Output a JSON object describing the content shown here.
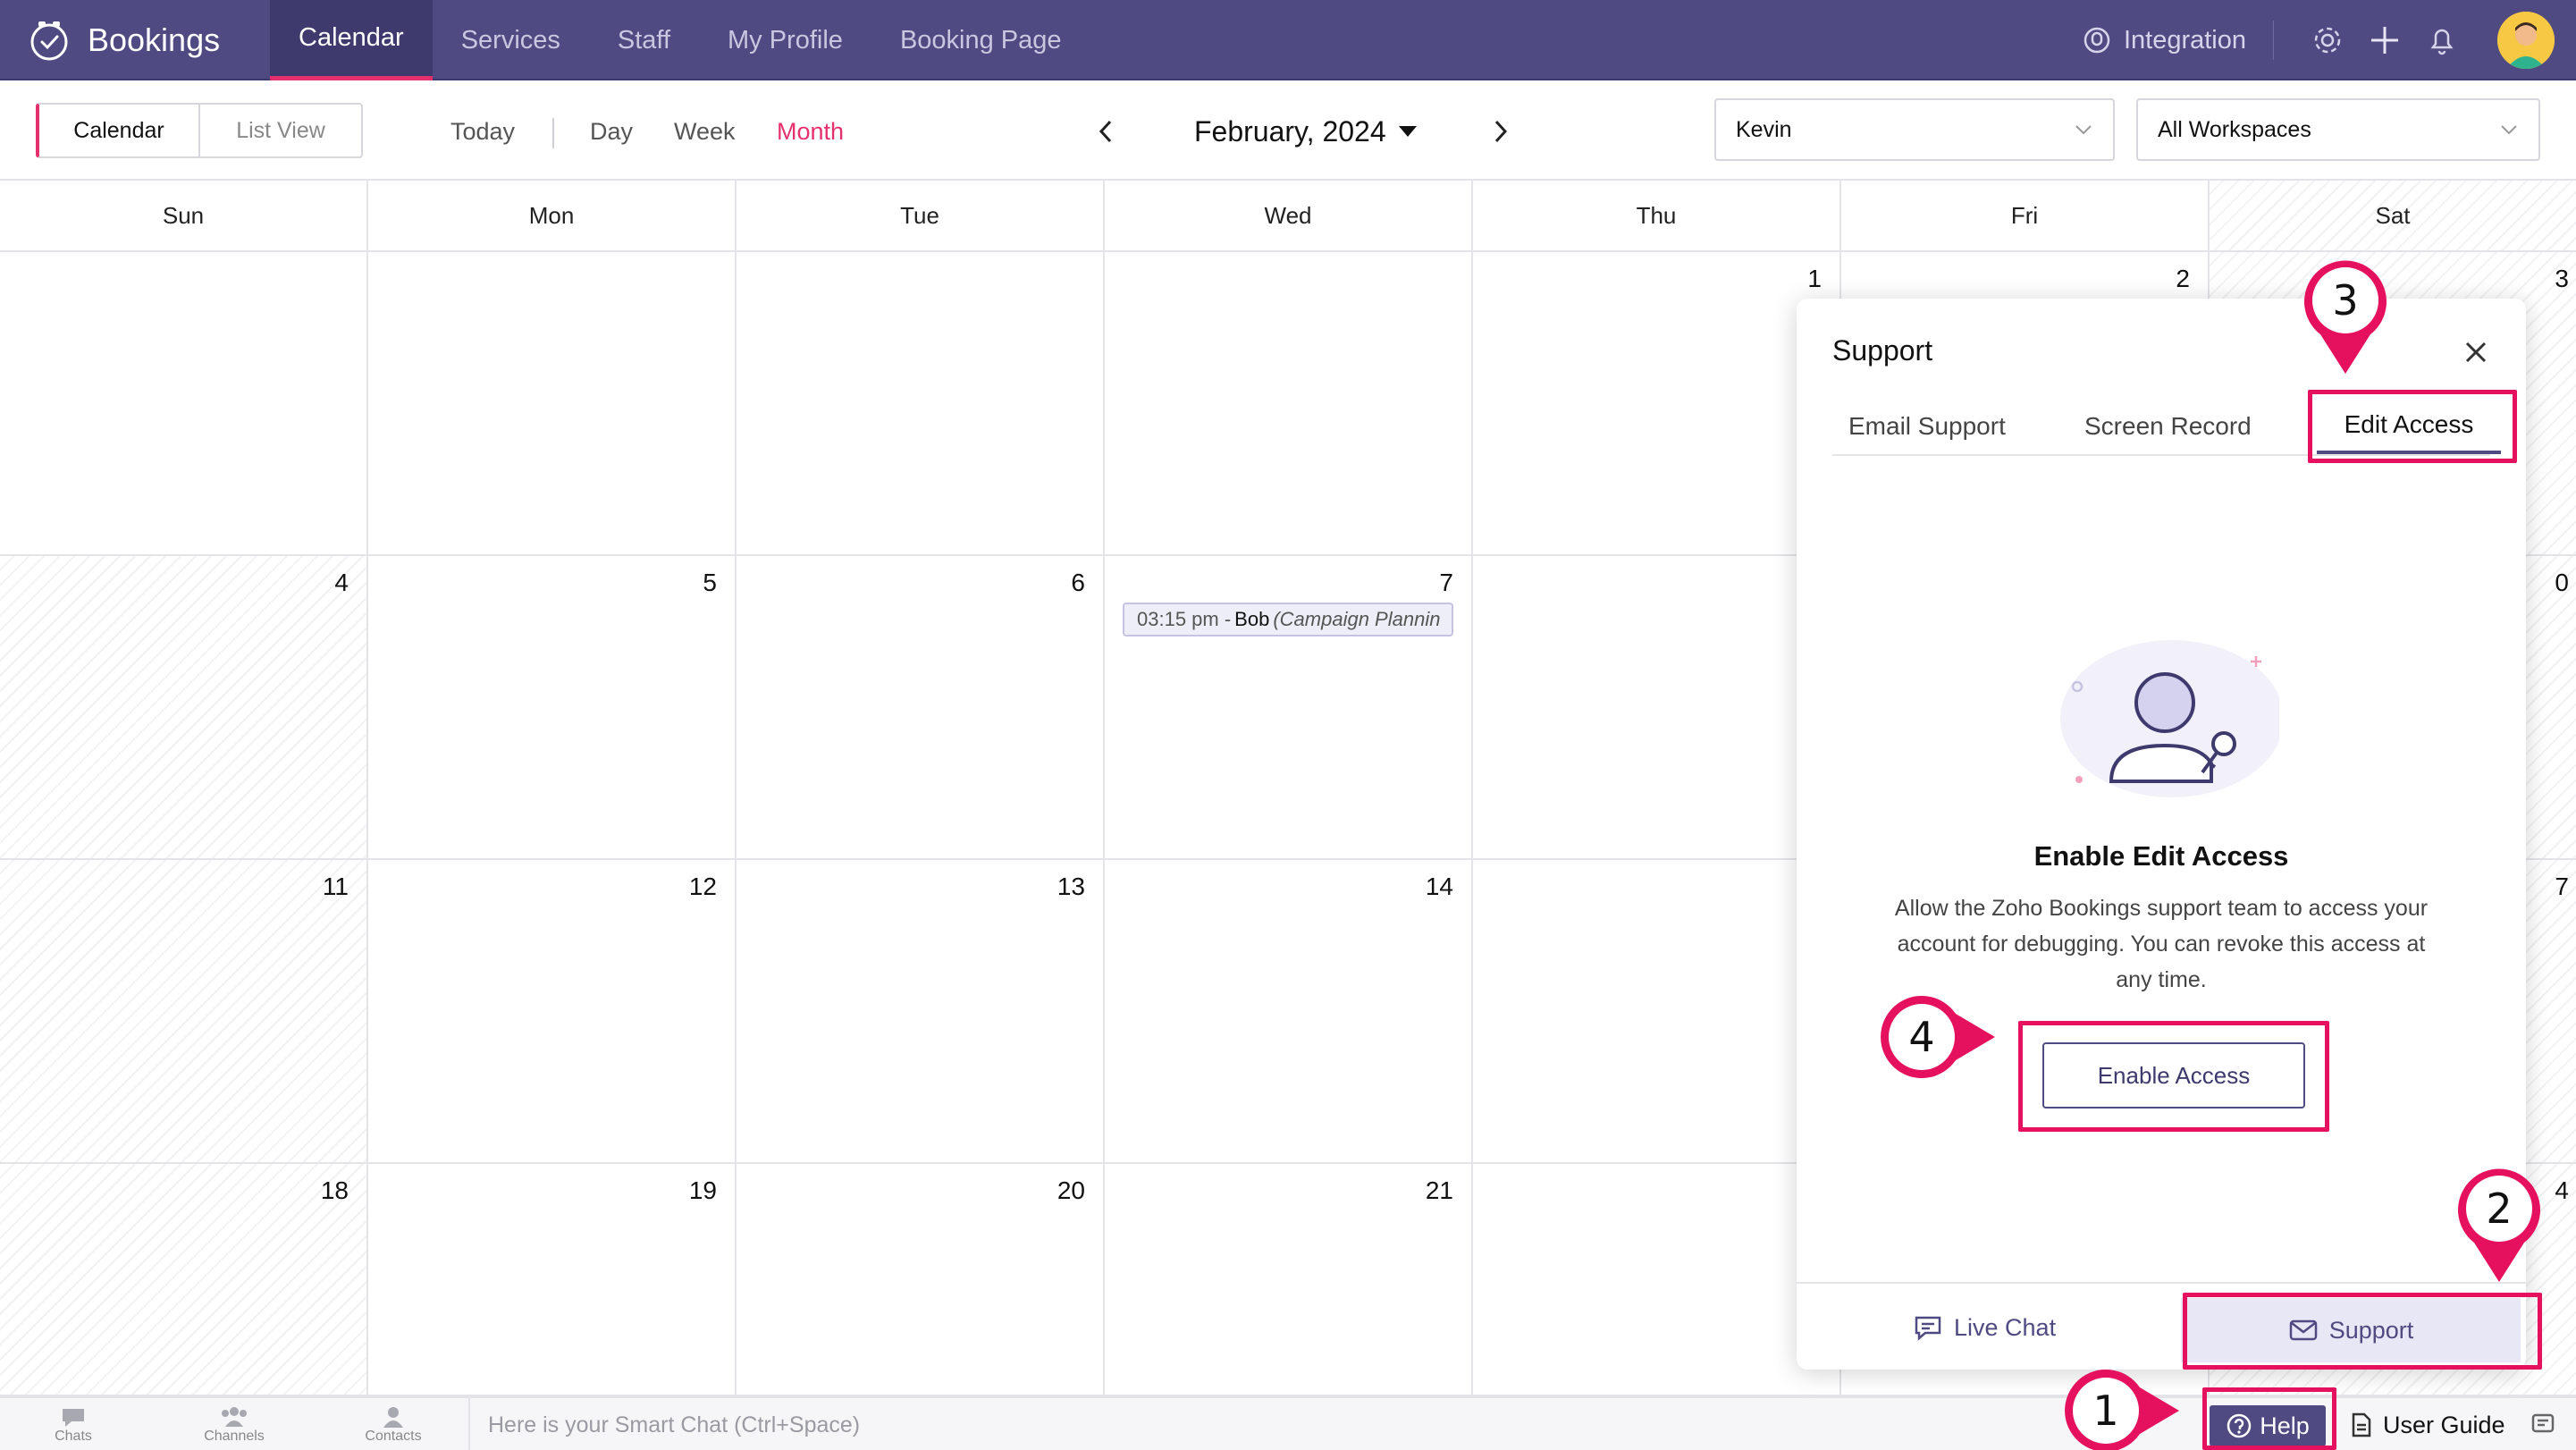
{
  "app": {
    "name": "Bookings"
  },
  "nav": {
    "tabs": [
      {
        "label": "Calendar",
        "active": true
      },
      {
        "label": "Services"
      },
      {
        "label": "Staff"
      },
      {
        "label": "My Profile"
      },
      {
        "label": "Booking Page"
      }
    ],
    "integration_label": "Integration",
    "icons": [
      "gear-icon",
      "plus-icon",
      "bell-icon",
      "avatar"
    ]
  },
  "toolbar": {
    "view_toggle": [
      "Calendar",
      "List View"
    ],
    "today": "Today",
    "ranges": [
      "Day",
      "Week",
      "Month"
    ],
    "active_range": "Month",
    "month_title": "February, 2024",
    "staff_select": "Kevin",
    "workspace_select": "All Workspaces"
  },
  "calendar": {
    "weekdays": [
      "Sun",
      "Mon",
      "Tue",
      "Wed",
      "Thu",
      "Fri",
      "Sat"
    ],
    "weeks": [
      [
        "",
        "",
        "",
        "",
        "1",
        "2",
        "3"
      ],
      [
        "4",
        "5",
        "6",
        "7",
        "",
        "",
        "0"
      ],
      [
        "11",
        "12",
        "13",
        "14",
        "1",
        "",
        "7"
      ],
      [
        "18",
        "19",
        "20",
        "21",
        "2",
        "",
        "4"
      ]
    ],
    "event": {
      "time": "03:15 pm -",
      "name": "Bob",
      "title": "(Campaign Plannin"
    }
  },
  "support_panel": {
    "title": "Support",
    "tabs": [
      "Email Support",
      "Screen Record",
      "Edit Access"
    ],
    "active_tab": "Edit Access",
    "heading": "Enable Edit Access",
    "description": "Allow the Zoho Bookings support team to access your account for debugging. You can revoke this access at any time.",
    "button": "Enable Access",
    "footer": {
      "live_chat": "Live Chat",
      "support": "Support"
    }
  },
  "bottom_bar": {
    "items": [
      "Chats",
      "Channels",
      "Contacts"
    ],
    "smart_chat": "Here is your Smart Chat (Ctrl+Space)",
    "help": "Help",
    "user_guide": "User Guide"
  },
  "annotations": [
    "1",
    "2",
    "3",
    "4"
  ],
  "colors": {
    "brand": "#4f4a82",
    "accent": "#e5306e",
    "annotation": "#e5105e"
  }
}
